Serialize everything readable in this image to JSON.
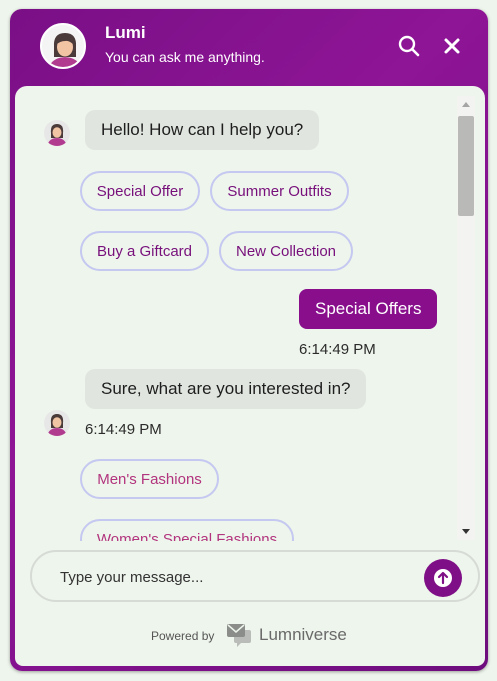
{
  "header": {
    "bot_name": "Lumi",
    "subtitle": "You can ask me anything.",
    "icons": [
      "search-icon",
      "close-icon"
    ]
  },
  "messages": [
    {
      "from": "bot",
      "text": "Hello! How can I help you?"
    },
    {
      "from": "user",
      "text": "Special Offers",
      "time": "6:14:49 PM"
    },
    {
      "from": "bot",
      "text": "Sure, what are you interested in?",
      "time": "6:14:49 PM"
    }
  ],
  "quick_replies_1": [
    "Special Offer",
    "Summer Outfits",
    "Buy a Giftcard",
    "New Collection"
  ],
  "quick_replies_2": [
    "Men's Fashions",
    "Women's Special Fashions"
  ],
  "input": {
    "placeholder": "Type your message..."
  },
  "footer": {
    "powered_by": "Powered by",
    "brand": "Lumniverse"
  },
  "colors": {
    "brand": "#880e8c",
    "background": "#eef5ec",
    "chip_border": "#c5c8f0"
  }
}
